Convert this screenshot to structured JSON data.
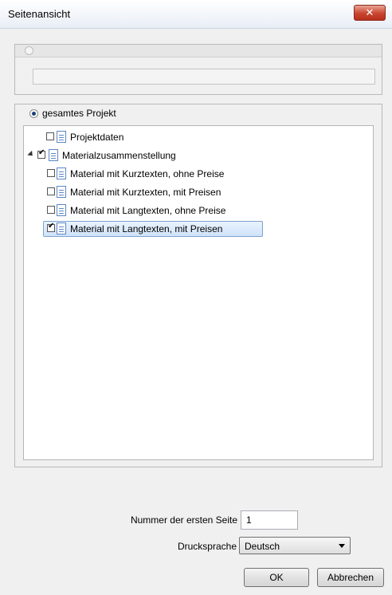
{
  "window": {
    "title": "Seitenansicht",
    "close_symbol": "✕"
  },
  "scope": {
    "option_all_label": "gesamtes Projekt"
  },
  "tree": {
    "items": [
      {
        "label": "Projektdaten",
        "checked": false
      },
      {
        "label": "Materialzusammenstellung",
        "checked": true,
        "expanded": true
      },
      {
        "label": "Material mit Kurztexten, ohne Preise",
        "checked": false
      },
      {
        "label": "Material mit Kurztexten, mit Preisen",
        "checked": false
      },
      {
        "label": "Material mit Langtexten, ohne Preise",
        "checked": false
      },
      {
        "label": "Material mit Langtexten, mit Preisen",
        "checked": true,
        "selected": true
      }
    ]
  },
  "footer": {
    "first_page_label": "Nummer der ersten Seite",
    "first_page_value": "1",
    "print_language_label": "Drucksprache",
    "print_language_value": "Deutsch",
    "ok_label": "OK",
    "cancel_label": "Abbrechen"
  },
  "colors": {
    "selection": "#cfe3fa",
    "close_button": "#c8452f"
  }
}
